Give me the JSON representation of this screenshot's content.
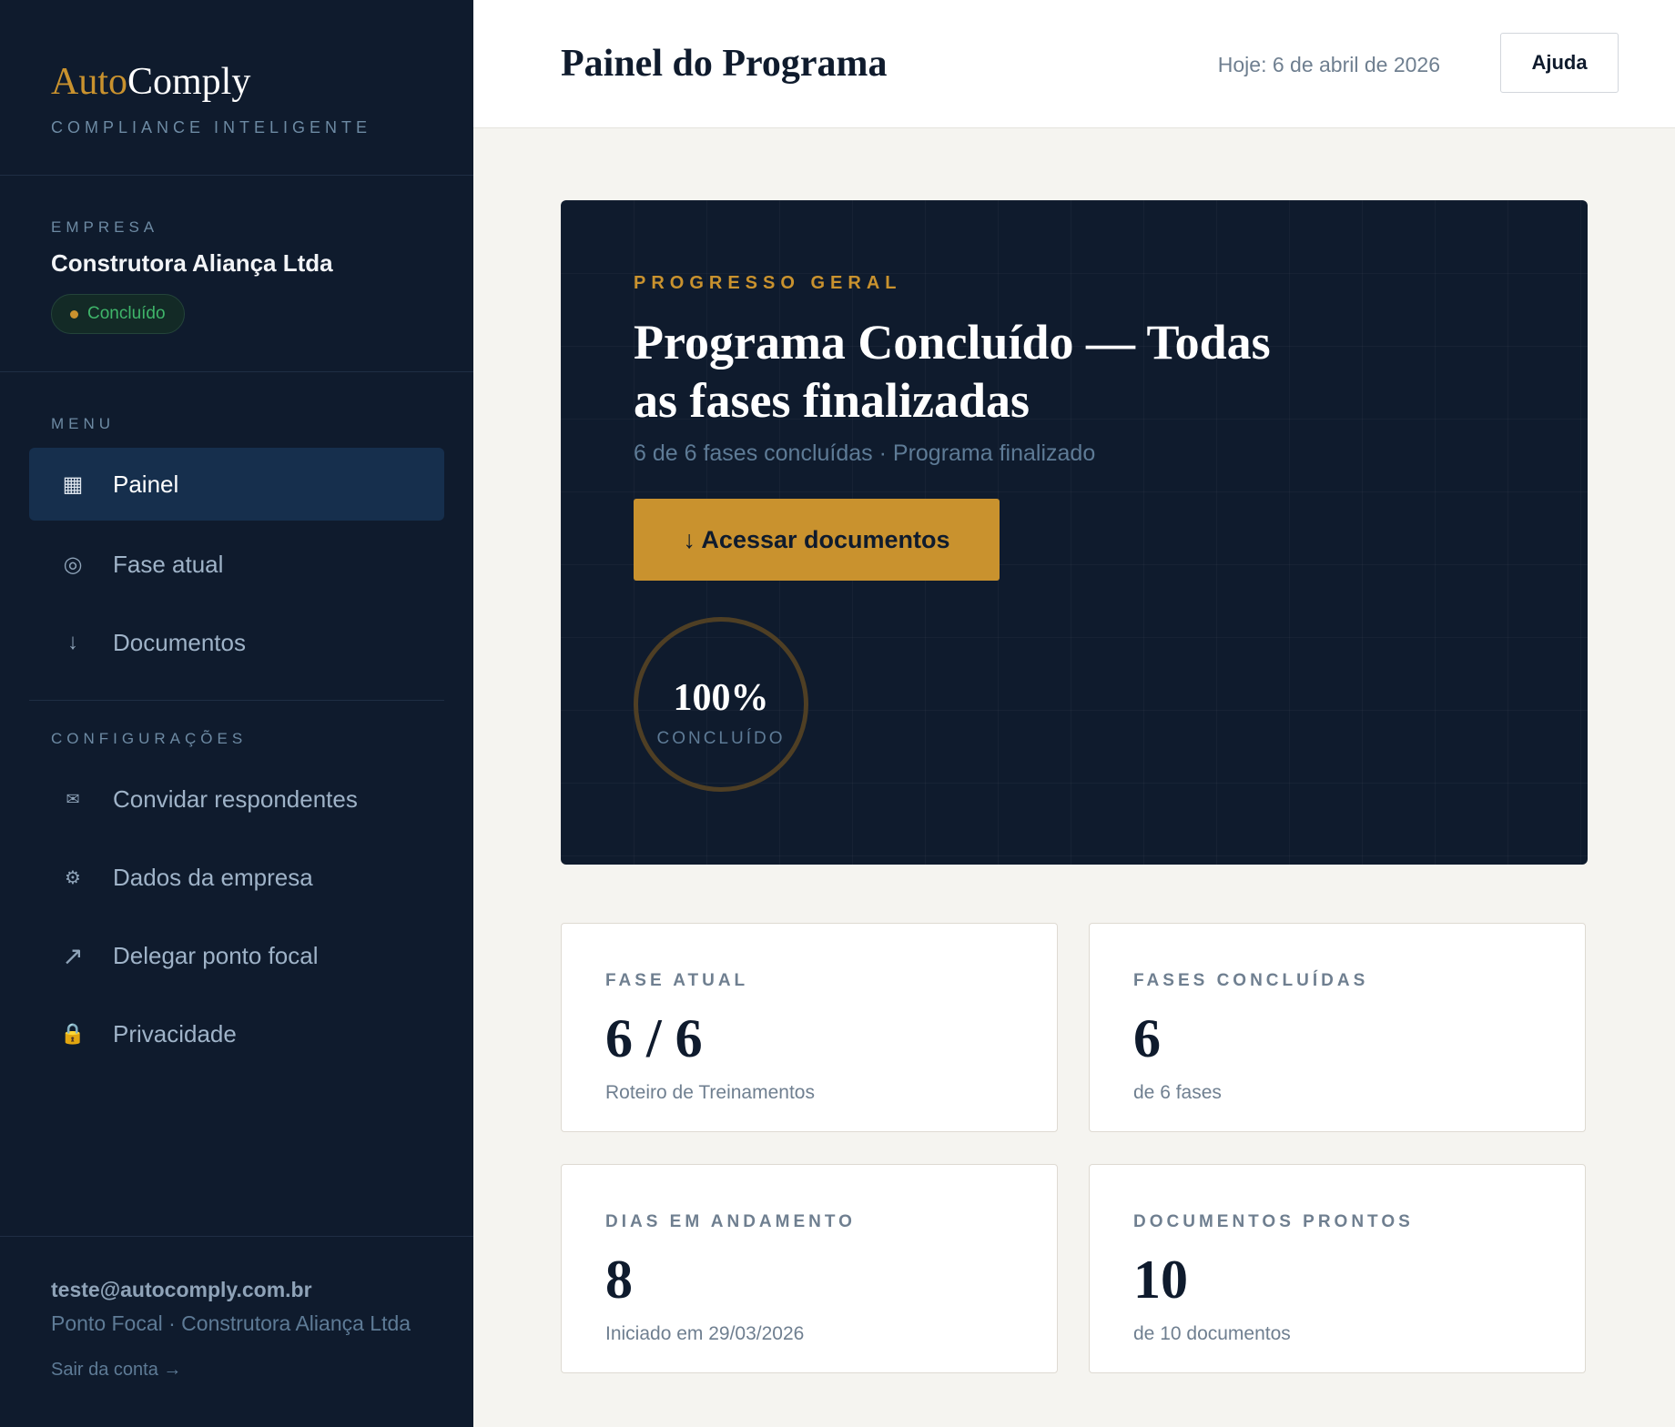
{
  "brand": {
    "name_a": "Auto",
    "name_b": "Comply",
    "tagline": "COMPLIANCE INTELIGENTE",
    "accent": "#c9922e"
  },
  "company": {
    "label": "EMPRESA",
    "name": "Construtora Aliança Ltda",
    "status": "Concluído"
  },
  "menu": {
    "label": "MENU",
    "items": [
      {
        "label": "Painel",
        "icon": "grid-icon",
        "glyph": "▦"
      },
      {
        "label": "Fase atual",
        "icon": "target-icon",
        "glyph": "◎"
      },
      {
        "label": "Documentos",
        "icon": "download-icon",
        "glyph": "↓"
      }
    ]
  },
  "settings": {
    "label": "CONFIGURAÇÕES",
    "items": [
      {
        "label": "Convidar respondentes",
        "icon": "envelope-icon",
        "glyph": "✉"
      },
      {
        "label": "Dados da empresa",
        "icon": "gear-icon",
        "glyph": "⚙"
      },
      {
        "label": "Delegar ponto focal",
        "icon": "arrow-up-right-icon",
        "glyph": "↗"
      },
      {
        "label": "Privacidade",
        "icon": "lock-icon",
        "glyph": "🔒"
      }
    ]
  },
  "user": {
    "email": "teste@autocomply.com.br",
    "role": "Ponto Focal · Construtora Aliança Ltda",
    "logout": "Sair da conta →"
  },
  "header": {
    "title": "Painel do Programa",
    "today": "Hoje: 6 de abril de 2026",
    "help": "Ajuda"
  },
  "hero": {
    "kicker": "PROGRESSO GERAL",
    "title": "Programa Concluído — Todas as fases finalizadas",
    "subtitle": "6 de 6 fases concluídas · Programa finalizado",
    "cta": "↓ Acessar documentos",
    "percent_label": "100%",
    "percent_value": 100,
    "percent_caption": "CONCLUÍDO"
  },
  "stats": [
    {
      "label": "FASE ATUAL",
      "value": "6 / 6",
      "sub": "Roteiro de Treinamentos"
    },
    {
      "label": "FASES CONCLUÍDAS",
      "value": "6",
      "sub": "de 6 fases"
    },
    {
      "label": "DIAS EM ANDAMENTO",
      "value": "8",
      "sub": "Iniciado em 29/03/2026"
    },
    {
      "label": "DOCUMENTOS PRONTOS",
      "value": "10",
      "sub": "de 10 documentos"
    }
  ]
}
